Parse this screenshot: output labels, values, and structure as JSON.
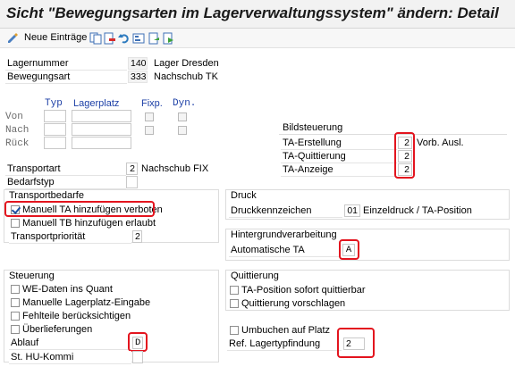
{
  "window": {
    "title": "Sicht \"Bewegungsarten im Lagerverwaltungssystem\" ändern: Detail"
  },
  "toolbar": {
    "new_entries_label": "Neue Einträge",
    "icons": [
      "display-change-icon",
      "copy-icon",
      "delete-icon",
      "undo-icon",
      "nav-icon",
      "prev-entry-icon",
      "next-entry-icon"
    ]
  },
  "header": {
    "warehouse_label": "Lagernummer",
    "warehouse_value": "140",
    "warehouse_text": "Lager Dresden",
    "movement_label": "Bewegungsart",
    "movement_value": "333",
    "movement_text": "Nachschub TK"
  },
  "grid": {
    "col_typ": "Typ",
    "col_lagerplatz": "Lagerplatz",
    "col_fixp": "Fixp.",
    "col_dyn": "Dyn.",
    "rows": [
      "Von",
      "Nach",
      "Rück"
    ]
  },
  "bildsteuerung": {
    "title": "Bildsteuerung",
    "rows": [
      {
        "label": "TA-Erstellung",
        "value": "2",
        "extra": "Vorb. Ausl."
      },
      {
        "label": "TA-Quittierung",
        "value": "2",
        "extra": ""
      },
      {
        "label": "TA-Anzeige",
        "value": "2",
        "extra": ""
      }
    ]
  },
  "transport": {
    "type_label": "Transportart",
    "type_value": "2",
    "type_text": "Nachschub FIX",
    "need_type_label": "Bedarfstyp",
    "need_type_value": ""
  },
  "transportbedarfe": {
    "title": "Transportbedarfe",
    "manual_ta_label": "Manuell TA hinzufügen verboten",
    "manual_ta_checked": true,
    "manual_tb_label": "Manuell TB hinzufügen erlaubt",
    "manual_tb_checked": false,
    "priority_label": "Transportpriorität",
    "priority_value": "2"
  },
  "druck": {
    "title": "Druck",
    "code_label": "Druckkennzeichen",
    "code_value": "01",
    "code_text": "Einzeldruck / TA-Position"
  },
  "hintergrund": {
    "title": "Hintergrundverarbeitung",
    "auto_ta_label": "Automatische TA",
    "auto_ta_value": "A"
  },
  "steuerung": {
    "title": "Steuerung",
    "checkboxes": [
      {
        "label": "WE-Daten ins Quant",
        "checked": false
      },
      {
        "label": "Manuelle Lagerplatz-Eingabe",
        "checked": false
      },
      {
        "label": "Fehlteile berücksichtigen",
        "checked": false
      },
      {
        "label": "Überlieferungen",
        "checked": false
      }
    ],
    "ablauf_label": "Ablauf",
    "ablauf_value": "D",
    "hu_label": "St. HU-Kommi",
    "hu_value": ""
  },
  "quittierung": {
    "title": "Quittierung",
    "checkboxes": [
      {
        "label": "TA-Position sofort quittierbar",
        "checked": false
      },
      {
        "label": "Quittierung vorschlagen",
        "checked": false
      }
    ]
  },
  "umbuchen": {
    "label": "Umbuchen auf Platz",
    "checked": false,
    "ref_label": "Ref. Lagertypfindung",
    "ref_value": "2"
  },
  "colors": {
    "highlight": "#e3141e",
    "column_header": "#1c3fa6"
  }
}
